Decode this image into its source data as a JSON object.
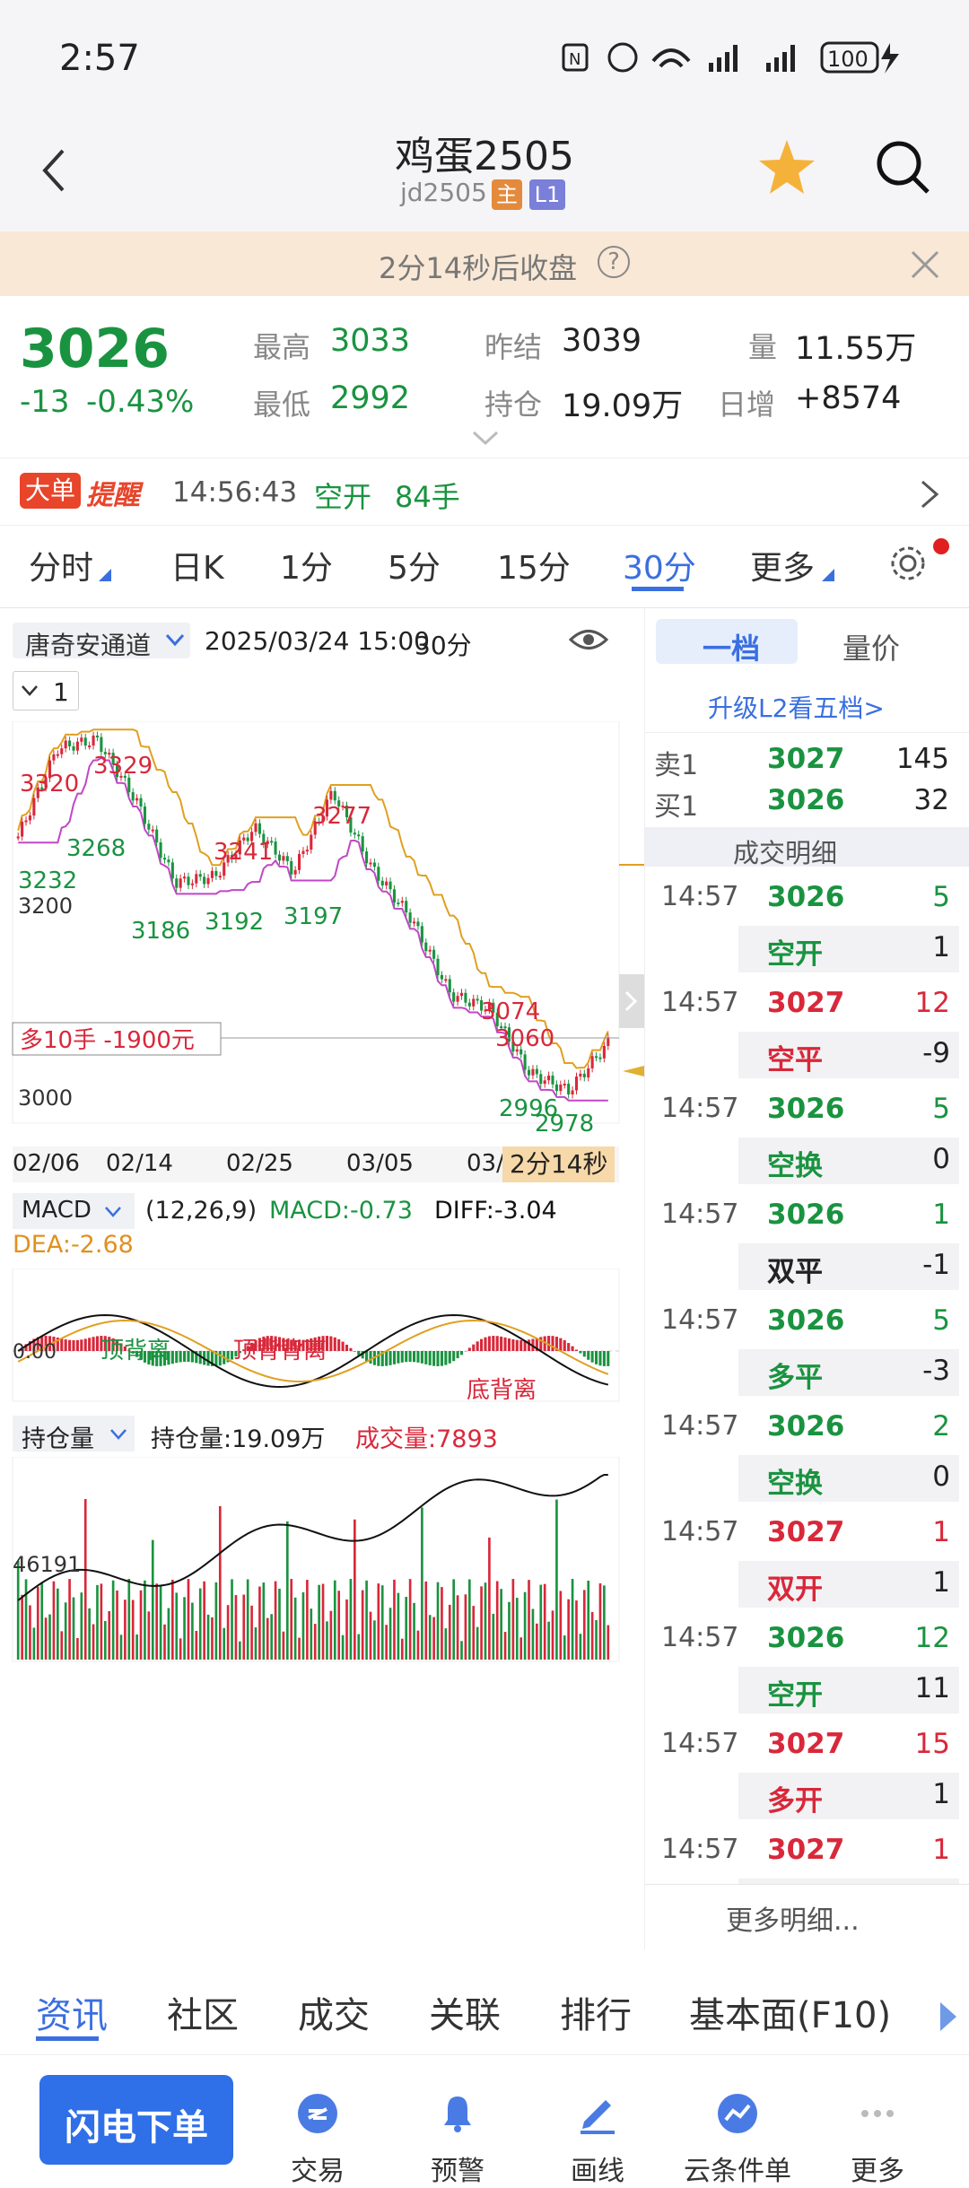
{
  "status": {
    "time": "2:57",
    "battery": "100"
  },
  "header": {
    "title": "鸡蛋2505",
    "code": "jd2505",
    "badge_main": "主",
    "badge_level": "L1"
  },
  "banner": {
    "text": "2分14秒后收盘",
    "help": "?"
  },
  "quote": {
    "price": "3026",
    "change": "-13",
    "change_pct": "-0.43%",
    "high_label": "最高",
    "high": "3033",
    "low_label": "最低",
    "low": "2992",
    "prev_label": "昨结",
    "prev": "3039",
    "oi_label": "持仓",
    "oi": "19.09万",
    "vol_label": "量",
    "vol": "11.55万",
    "inc_label": "日增",
    "inc": "+8574"
  },
  "alert": {
    "tag1": "大单",
    "tag2": "提醒",
    "time": "14:56:43",
    "action": "空开",
    "qty": "84手"
  },
  "periods": {
    "items": [
      "分时",
      "日K",
      "1分",
      "5分",
      "15分",
      "30分",
      "更多"
    ],
    "active": "30分"
  },
  "chart_toolbar": {
    "channel": "唐奇安通道",
    "datetime": "2025/03/24 15:00",
    "period": "30分",
    "count": "1"
  },
  "kline": {
    "annotations": [
      "3320",
      "3329",
      "3268",
      "3232",
      "3200",
      "3241",
      "3277",
      "3186",
      "3192",
      "3197",
      "3074",
      "3060",
      "2996",
      "2978",
      "3000"
    ],
    "position_tag": "多10手 -1900元",
    "dates": [
      "02/06",
      "02/14",
      "02/25",
      "03/05",
      "03/"
    ],
    "countdown": "2分14秒"
  },
  "macd": {
    "label": "MACD",
    "params": "(12,26,9)",
    "macd": "MACD:-0.73",
    "diff": "DIFF:-3.04",
    "dea": "DEA:-2.68",
    "zero": "0.00",
    "div1": "顶背离",
    "div2": "顶背背离",
    "div3": "底背离"
  },
  "oi": {
    "label": "持仓量",
    "oi": "持仓量:19.09万",
    "vol": "成交量:7893",
    "axis": "46191"
  },
  "chart_data": [
    {
      "type": "line",
      "title": "",
      "xlabel": "",
      "ylabel": "",
      "x": [
        "02/06",
        "02/14",
        "02/25",
        "03/05",
        "03/24"
      ],
      "series": [
        {
          "values": [
            3232,
            3320,
            3329,
            3268,
            3186,
            3192,
            3241,
            3197,
            3277,
            3200,
            3150,
            3074,
            3060,
            2996,
            2978,
            3026
          ]
        }
      ],
      "ylim": [
        2960,
        3340
      ],
      "grid": false
    },
    {
      "type": "bar",
      "title": "",
      "xlabel": "",
      "ylabel": "",
      "series": [
        {
          "name": "MACD",
          "values": [
            -0.73
          ]
        },
        {
          "name": "DIFF",
          "values": [
            -3.04
          ]
        },
        {
          "name": "DEA",
          "values": [
            -2.68
          ]
        }
      ],
      "grid": false
    },
    {
      "type": "bar",
      "title": "",
      "xlabel": "",
      "ylabel": "",
      "series": [
        {
          "name": "持仓量",
          "values": [
            190900
          ]
        },
        {
          "name": "成交量",
          "values": [
            7893
          ]
        }
      ],
      "grid": false
    }
  ],
  "depth": {
    "tab1": "一档",
    "tab2": "量价",
    "upgrade": "升级L2看五档>",
    "ask_label": "卖1",
    "ask_price": "3027",
    "ask_vol": "145",
    "bid_label": "买1",
    "bid_price": "3026",
    "bid_vol": "32",
    "detail_title": "成交明细",
    "rows": [
      {
        "time": "14:57",
        "price": "3026",
        "vol": "5",
        "kind": "空开",
        "chg": "1",
        "pc": "green",
        "kc": "green"
      },
      {
        "time": "14:57",
        "price": "3027",
        "vol": "12",
        "kind": "空平",
        "chg": "-9",
        "pc": "red",
        "kc": "red"
      },
      {
        "time": "14:57",
        "price": "3026",
        "vol": "5",
        "kind": "空换",
        "chg": "0",
        "pc": "green",
        "kc": "green"
      },
      {
        "time": "14:57",
        "price": "3026",
        "vol": "1",
        "kind": "双平",
        "chg": "-1",
        "pc": "green",
        "kc": "black"
      },
      {
        "time": "14:57",
        "price": "3026",
        "vol": "5",
        "kind": "多平",
        "chg": "-3",
        "pc": "green",
        "kc": "green"
      },
      {
        "time": "14:57",
        "price": "3026",
        "vol": "2",
        "kind": "空换",
        "chg": "0",
        "pc": "green",
        "kc": "green"
      },
      {
        "time": "14:57",
        "price": "3027",
        "vol": "1",
        "kind": "双开",
        "chg": "1",
        "pc": "red",
        "kc": "red"
      },
      {
        "time": "14:57",
        "price": "3026",
        "vol": "12",
        "kind": "空开",
        "chg": "11",
        "pc": "green",
        "kc": "green"
      },
      {
        "time": "14:57",
        "price": "3027",
        "vol": "15",
        "kind": "多开",
        "chg": "1",
        "pc": "red",
        "kc": "red"
      },
      {
        "time": "14:57",
        "price": "3027",
        "vol": "1",
        "kind": "",
        "chg": "",
        "pc": "red",
        "kc": "red"
      }
    ],
    "more": "更多明细..."
  },
  "bottom_tabs": {
    "items": [
      "资讯",
      "社区",
      "成交",
      "关联",
      "排行",
      "基本面(F10)"
    ]
  },
  "toolbar": {
    "order": "闪电下单",
    "items": [
      "交易",
      "预警",
      "画线",
      "云条件单",
      "更多"
    ]
  }
}
